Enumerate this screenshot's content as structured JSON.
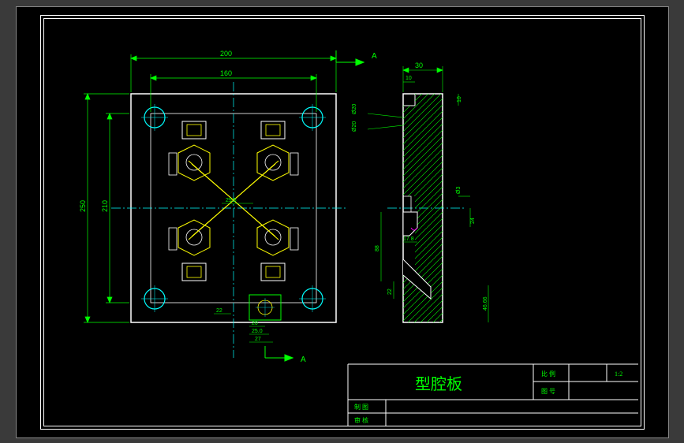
{
  "title_block": {
    "title": "型腔板",
    "scale_label": "比  例",
    "scale_value": "1:2",
    "drawing_no_label": "图  号",
    "drawing_no_value": "",
    "drawn_label": "制  图",
    "checked_label": "审  核"
  },
  "section_marks": {
    "top": "A",
    "bottom": "A"
  },
  "dimensions": {
    "top_200": "200",
    "top_160": "160",
    "left_250": "250",
    "left_210": "210",
    "center_296": "29.6",
    "center_tol": "",
    "bottom_22": "22",
    "bottom_20": "20",
    "bottom_25": "25.0",
    "bottom_27": "27",
    "sec_30": "30",
    "sec_10a": "10",
    "sec_10b": "10",
    "sec_dia20a": "Ø20",
    "sec_dia20b": "Ø20",
    "sec_dia3": "Ø3",
    "sec_24": "24",
    "sec_178": "17.8",
    "sec_64_h": "",
    "sec_88": "88",
    "sec_22b": "22",
    "sec_4666": "46.66",
    "sec_ang1": "",
    "sec_ang2": ""
  },
  "colors": {
    "geom": "#ffffff",
    "dim": "#00ff00",
    "center": "#00ffff",
    "hatch": "#00ff00",
    "aux": "#ffff00",
    "sec": "#ff00ff"
  }
}
